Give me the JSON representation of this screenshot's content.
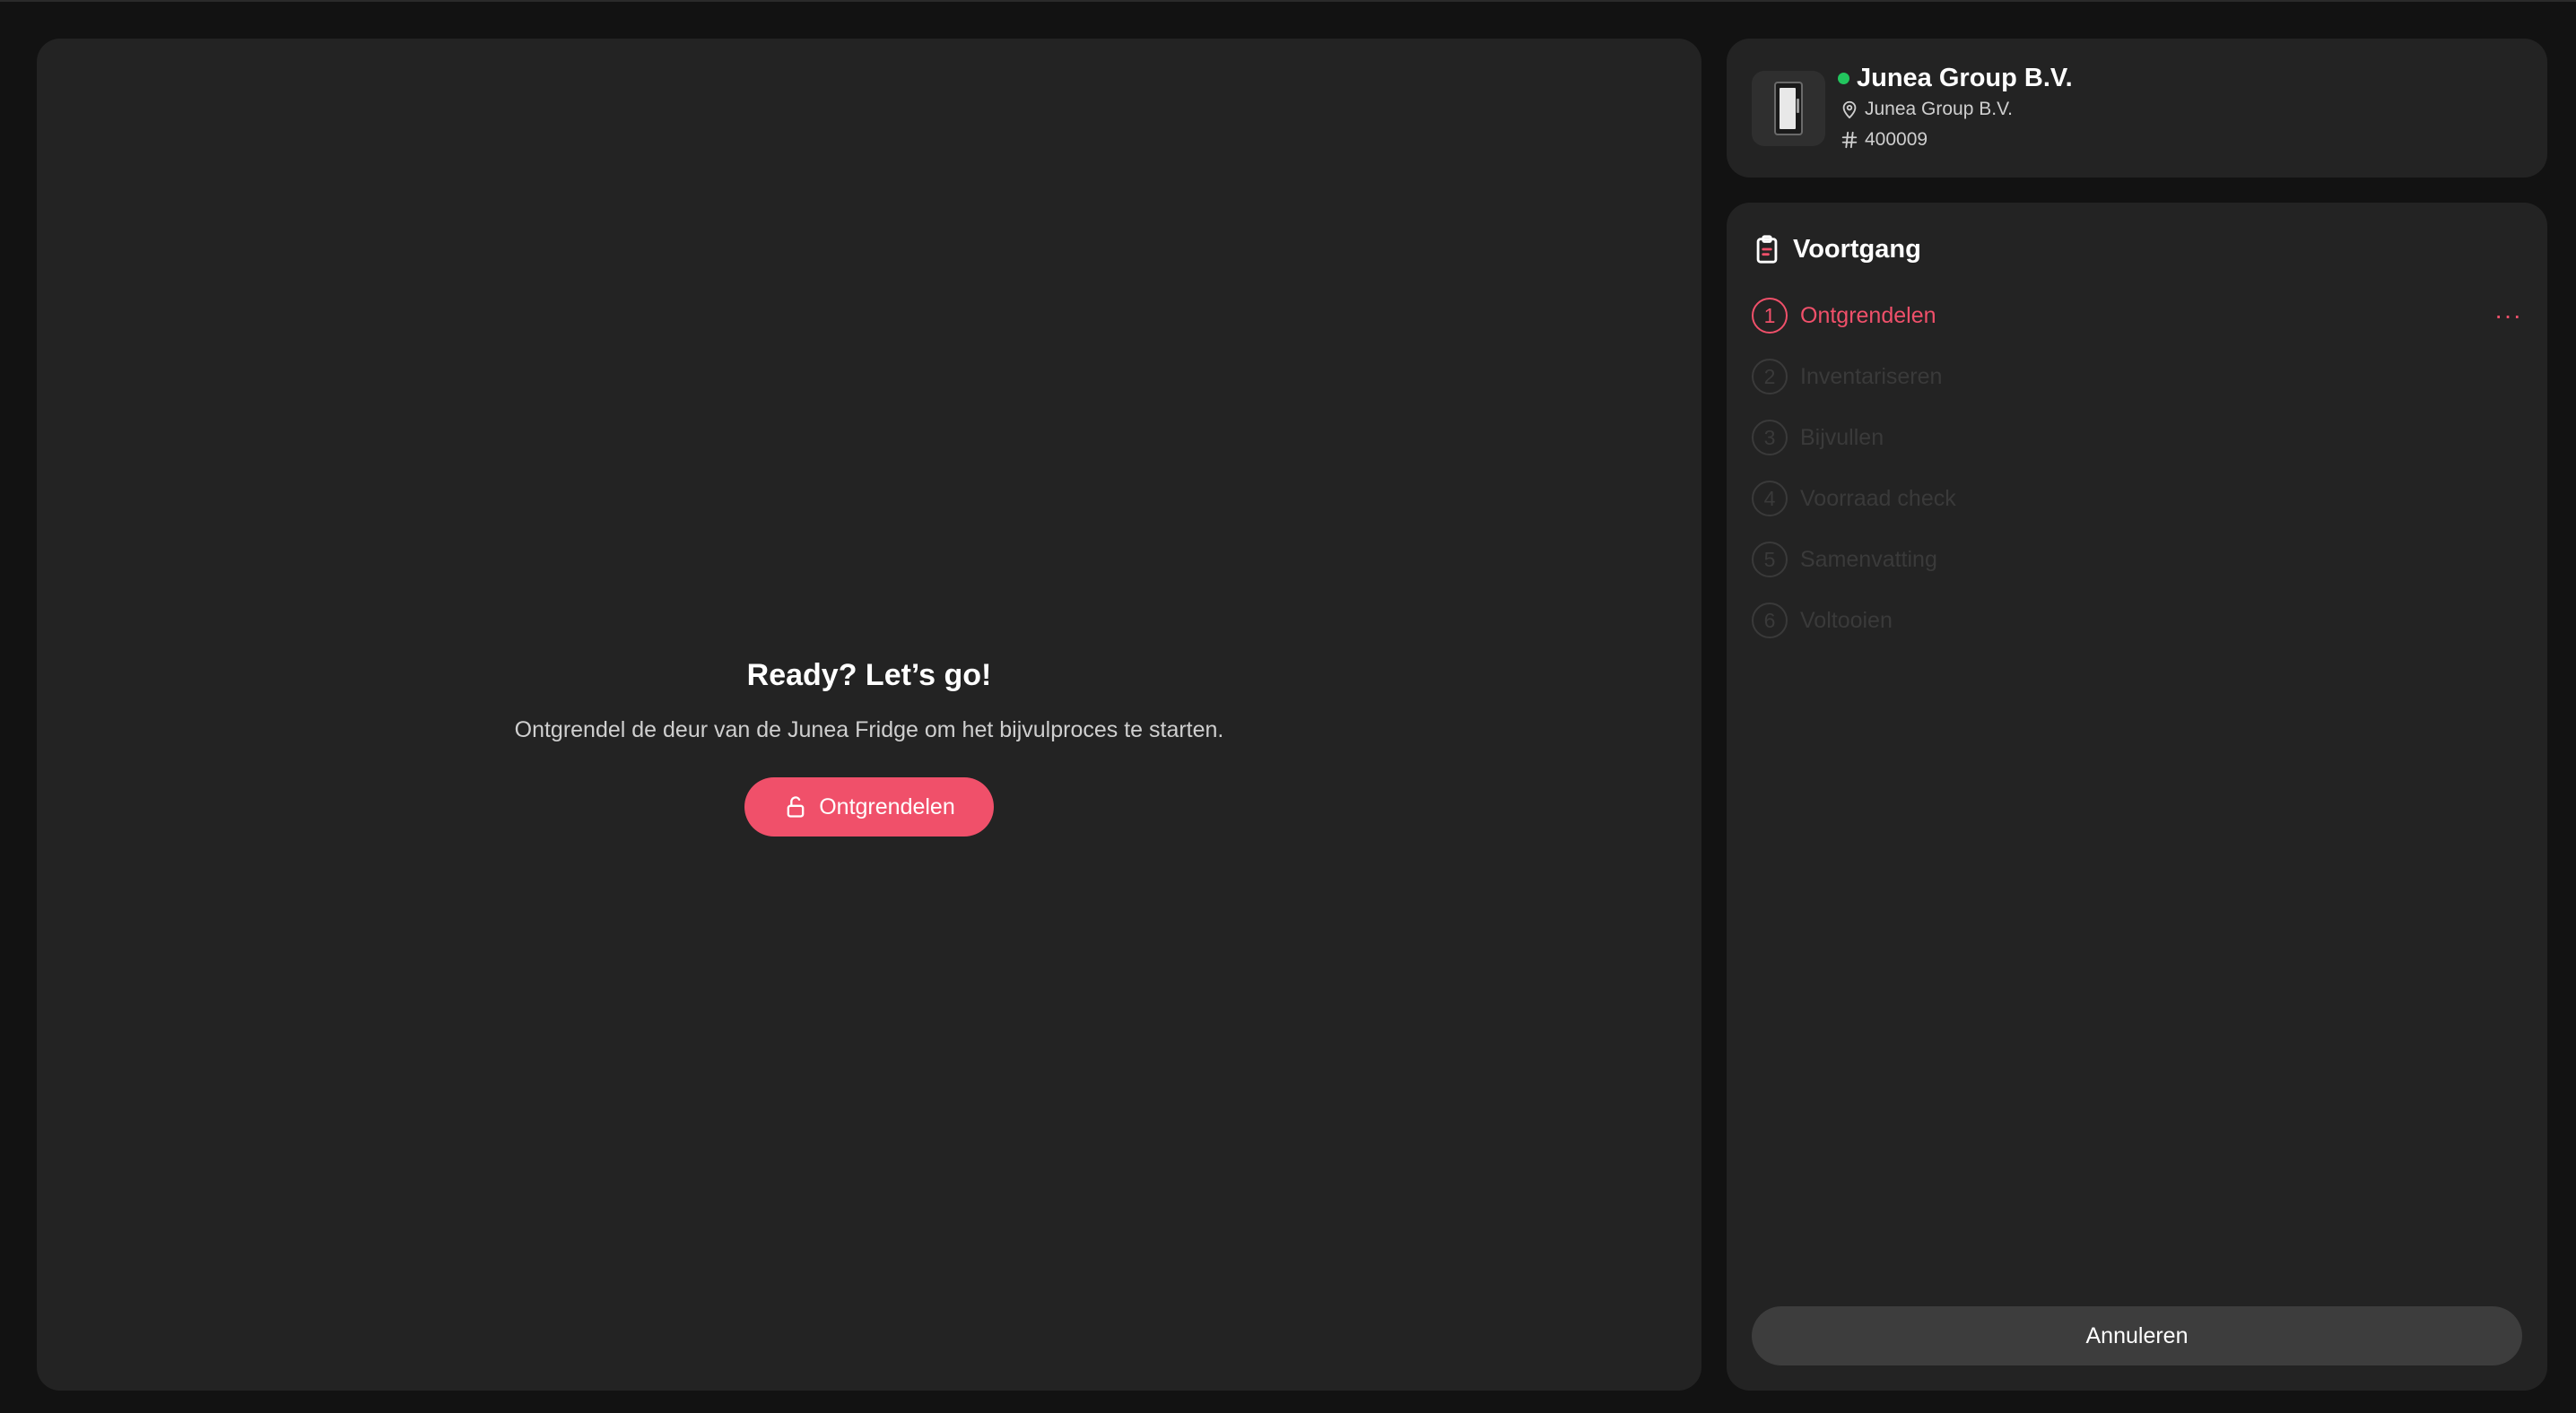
{
  "main": {
    "title": "Ready? Let’s go!",
    "subtitle": "Ontgrendel de deur van de Junea Fridge om het bijvulproces te starten.",
    "unlock_label": "Ontgrendelen",
    "unlock_icon": "lock-open-icon",
    "accent_color": "#f0506a"
  },
  "device": {
    "name": "Junea Group B.V.",
    "status": "online",
    "status_color": "#22c55e",
    "location": "Junea Group B.V.",
    "location_icon": "map-pin-icon",
    "id": "400009",
    "id_icon": "hash-icon"
  },
  "progress": {
    "title": "Voortgang",
    "icon": "clipboard-icon",
    "steps": [
      {
        "num": "1",
        "label": "Ontgrendelen",
        "active": true
      },
      {
        "num": "2",
        "label": "Inventariseren",
        "active": false
      },
      {
        "num": "3",
        "label": "Bijvullen",
        "active": false
      },
      {
        "num": "4",
        "label": "Voorraad check",
        "active": false
      },
      {
        "num": "5",
        "label": "Samenvatting",
        "active": false
      },
      {
        "num": "6",
        "label": "Voltooien",
        "active": false
      }
    ],
    "more_label": "···",
    "cancel_label": "Annuleren"
  }
}
